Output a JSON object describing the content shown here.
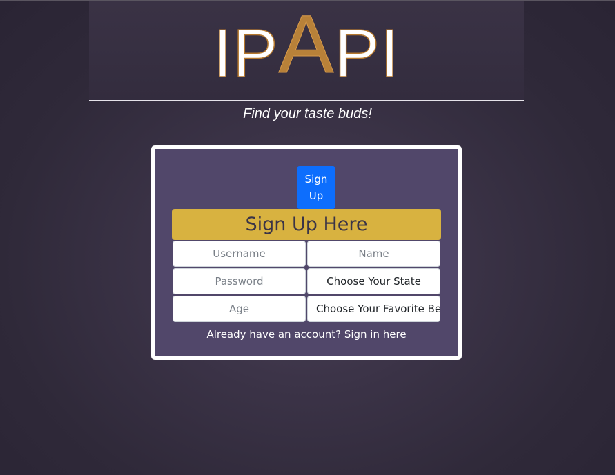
{
  "header": {
    "logo_part1": "IP",
    "logo_part2": "A",
    "logo_part3": "PI",
    "tagline": "Find your taste buds!"
  },
  "card": {
    "signup_button_label": "Sign Up",
    "banner": "Sign Up Here",
    "fields": {
      "username_placeholder": "Username",
      "name_placeholder": "Name",
      "password_placeholder": "Password",
      "state_select": "Choose Your State",
      "age_placeholder": "Age",
      "favorite_select": "Choose Your Favorite Be"
    },
    "signin_link": "Already have an account? Sign in here"
  },
  "colors": {
    "background": "#2f2939",
    "card": "#51476a",
    "banner": "#d8b240",
    "button": "#0d6efd",
    "logo_accent": "#b88139"
  }
}
